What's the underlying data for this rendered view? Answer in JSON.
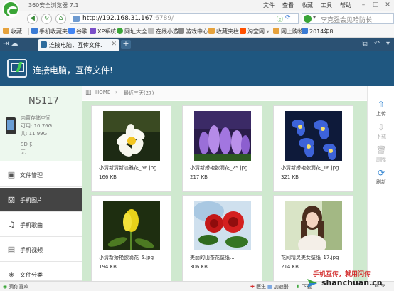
{
  "browser": {
    "title": "360安全浏览器 7.1",
    "menu": [
      "文件",
      "查看",
      "收藏",
      "工具",
      "帮助"
    ],
    "url_host": "http://192.168.31.167",
    "url_port": ":6789/",
    "search_placeholder": "李克强会见哈防长"
  },
  "favorites": [
    {
      "label": "收藏",
      "color": "#e6a23c"
    },
    {
      "label": "手机收藏夹",
      "color": "#3a7bd5"
    },
    {
      "label": "谷歌",
      "color": "#4285f4"
    },
    {
      "label": "XP系统",
      "color": "#7a4fc8"
    },
    {
      "label": "网址大全",
      "color": "#3aa537"
    },
    {
      "label": "在线小游",
      "color": "#888888"
    },
    {
      "label": "游戏中心",
      "color": "#888888"
    },
    {
      "label": "收藏夹栏",
      "color": "#e6a23c"
    },
    {
      "label": "淘宝网",
      "color": "#ff5000"
    },
    {
      "label": "网上购物",
      "color": "#e6a23c"
    },
    {
      "label": "2014年8",
      "color": "#3a7bd5"
    }
  ],
  "tab": {
    "label": "连接电脑，互传文件."
  },
  "header": {
    "title": "连接电脑，互传文件!"
  },
  "device": {
    "name": "N5117",
    "storage_label": "内置存储空间",
    "used": "可用: 10.76G",
    "total": "共: 11.99G",
    "sd_label": "SD卡",
    "sd_value": "无"
  },
  "nav": [
    {
      "label": "文件管理",
      "icon": "▣"
    },
    {
      "label": "手机图片",
      "icon": "▨"
    },
    {
      "label": "手机歌曲",
      "icon": "♫"
    },
    {
      "label": "手机视频",
      "icon": "▤"
    },
    {
      "label": "文件分类",
      "icon": "◈"
    }
  ],
  "breadcrumb": {
    "home": "HOME",
    "current": "最近三天(27)"
  },
  "files": [
    {
      "name": "小清新清新淡雅花_56.jpg",
      "size": "166 KB",
      "kind": "frangipani"
    },
    {
      "name": "小清新娇艳欲滴花_25.jpg",
      "size": "217 KB",
      "kind": "purple"
    },
    {
      "name": "小清新娇艳欲滴花_16.jpg",
      "size": "321 KB",
      "kind": "blue"
    },
    {
      "name": "小清新娇艳欲滴花_5.jpg",
      "size": "194 KB",
      "kind": "yellow"
    },
    {
      "name": "美丽的山茶花壁纸...",
      "size": "306 KB",
      "kind": "camellia"
    },
    {
      "name": "花间精灵美女壁纸_17.jpg",
      "size": "214 KB",
      "kind": "girl"
    }
  ],
  "actions": [
    {
      "label": "上传",
      "icon": "⇧",
      "color": "#2f82d0",
      "enabled": true
    },
    {
      "label": "下载",
      "icon": "⇩",
      "color": "#bbbbbb",
      "enabled": false
    },
    {
      "label": "删除",
      "icon": "🗑",
      "color": "#bbbbbb",
      "enabled": false
    },
    {
      "label": "刷新",
      "icon": "⟳",
      "color": "#2f82d0",
      "enabled": true
    }
  ],
  "status": {
    "left": "猜你喜欢",
    "doctor": "医生",
    "accel": "加速器",
    "download": "下载",
    "zoom": "100%"
  },
  "watermark": {
    "line1": "手机互传，就用闪传",
    "line2": "shanchuan.cn"
  }
}
